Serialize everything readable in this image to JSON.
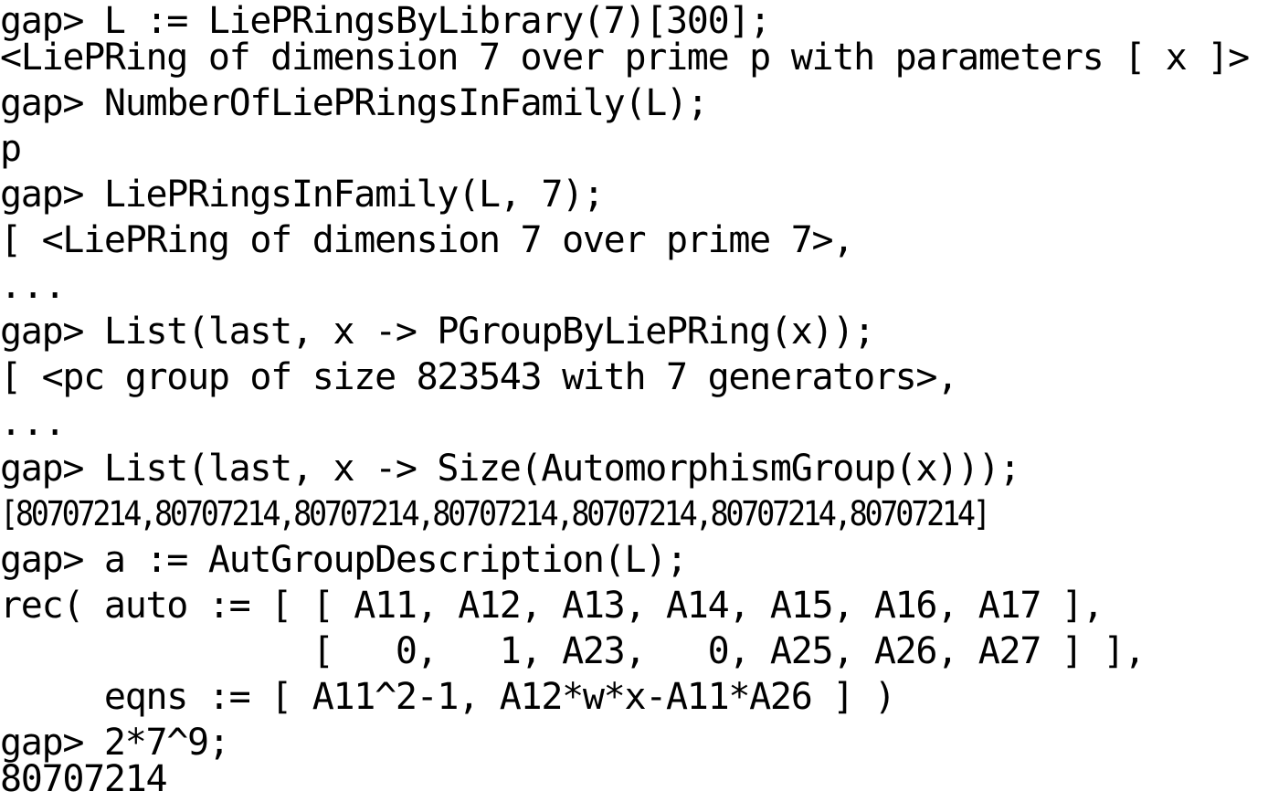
{
  "document": {
    "kind": "terminal-transcript",
    "program": "GAP",
    "prompt": "gap>",
    "background_color": "#ffffff",
    "text_color": "#000000",
    "line_count": 17
  },
  "transcript": {
    "lines": [
      {
        "index": 0,
        "type": "input",
        "text": "gap> L := LiePRingsByLibrary(7)[300];"
      },
      {
        "index": 1,
        "type": "output",
        "text": "<LiePRing of dimension 7 over prime p with parameters [ x ]>"
      },
      {
        "index": 2,
        "type": "input",
        "text": "gap> NumberOfLiePRingsInFamily(L);"
      },
      {
        "index": 3,
        "type": "output",
        "text": "p"
      },
      {
        "index": 4,
        "type": "input",
        "text": "gap> LiePRingsInFamily(L, 7);"
      },
      {
        "index": 5,
        "type": "output",
        "text": "[ <LiePRing of dimension 7 over prime 7>,"
      },
      {
        "index": 6,
        "type": "output",
        "text": "..."
      },
      {
        "index": 7,
        "type": "input",
        "text": "gap> List(last, x -> PGroupByLiePRing(x));"
      },
      {
        "index": 8,
        "type": "output",
        "text": "[ <pc group of size 823543 with 7 generators>,"
      },
      {
        "index": 9,
        "type": "output",
        "text": "..."
      },
      {
        "index": 10,
        "type": "input",
        "text": "gap> List(last, x -> Size(AutomorphismGroup(x)));"
      },
      {
        "index": 11,
        "type": "output",
        "text": "[80707214,80707214,80707214,80707214,80707214,80707214,80707214]"
      },
      {
        "index": 12,
        "type": "input",
        "text": "gap> a := AutGroupDescription(L);"
      },
      {
        "index": 13,
        "type": "output",
        "text": "rec( auto := [ [ A11, A12, A13, A14, A15, A16, A17 ],"
      },
      {
        "index": 14,
        "type": "output",
        "text": "               [   0,   1, A23,   0, A25, A26, A27 ] ],"
      },
      {
        "index": 15,
        "type": "output",
        "text": "     eqns := [ A11^2-1, A12*w*x-A11*A26 ] )"
      },
      {
        "index": 16,
        "type": "input",
        "text": "gap> 2*7^9;"
      },
      {
        "index": 17,
        "type": "output",
        "text": "80707214"
      }
    ]
  },
  "values": {
    "library_dimension": "7",
    "library_index": "300",
    "family_prime": "7",
    "family_count": "p",
    "pc_group_size": "823543",
    "pc_group_generators": "7",
    "automorphism_group_order": "80707214",
    "automorphism_group_order_repeats": "7",
    "power_expression": "2*7^9",
    "parameter_list": "[ x ]",
    "auto_row_1": "[ A11, A12, A13, A14, A15, A16, A17 ]",
    "auto_row_2": "[   0,   1, A23,   0, A25, A26, A27 ]",
    "eqns": "[ A11^2-1, A12*w*x-A11*A26 ]"
  }
}
